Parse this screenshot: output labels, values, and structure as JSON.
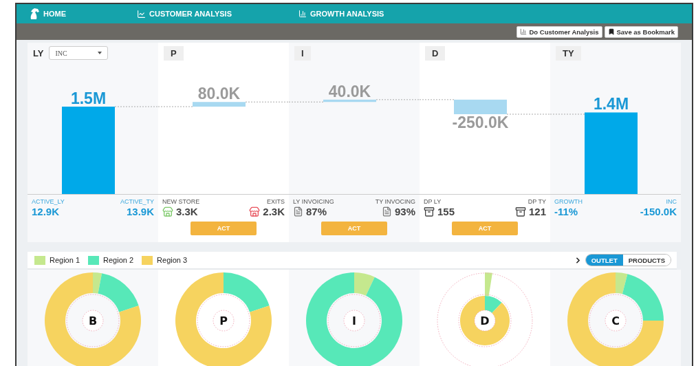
{
  "nav": {
    "items": [
      {
        "label": "HOME",
        "kind": "home"
      },
      {
        "label": "CUSTOMER ANALYSIS",
        "kind": "line"
      },
      {
        "label": "GROWTH ANALYSIS",
        "kind": "bars"
      }
    ]
  },
  "toolbar": {
    "buttons": [
      {
        "label": "Do Customer Analysis",
        "kind": "chart"
      },
      {
        "label": "Save as Bookmark",
        "kind": "bookmark"
      }
    ]
  },
  "waterfall": {
    "measure": {
      "value": "INC"
    },
    "columns": [
      {
        "category": "LY",
        "value": "1.5M"
      },
      {
        "category": "P",
        "value": "80.0K"
      },
      {
        "category": "I",
        "value": "40.0K"
      },
      {
        "category": "D",
        "value": "-250.0K"
      },
      {
        "category": "TY",
        "value": "1.4M"
      }
    ]
  },
  "metrics": [
    {
      "left": {
        "label": "ACTIVE_LY",
        "value": "12.9K",
        "kind": "accent"
      },
      "right": {
        "label": "ACTIVE_TY",
        "value": "13.9K",
        "kind": "accent"
      }
    },
    {
      "left": {
        "label": "NEW STORE",
        "value": "3.3K",
        "kind": "store",
        "color": "#7dc96a"
      },
      "right": {
        "label": "EXITS",
        "value": "2.3K",
        "kind": "store",
        "color": "#e8505b"
      },
      "action": "ACT"
    },
    {
      "left": {
        "label": "LY INVOICING",
        "value": "87%",
        "kind": "invoice"
      },
      "right": {
        "label": "TY INVOCING",
        "value": "93%",
        "kind": "invoice"
      },
      "action": "ACT"
    },
    {
      "left": {
        "label": "DP LY",
        "value": "155",
        "kind": "package"
      },
      "right": {
        "label": "DP TY",
        "value": "121",
        "kind": "package"
      },
      "action": "ACT"
    },
    {
      "left": {
        "label": "GROWTH",
        "value": "-11%",
        "kind": "accent"
      },
      "right": {
        "label": "INC",
        "value": "-150.0K",
        "kind": "accent"
      }
    }
  ],
  "legend": [
    {
      "label": "Region 1",
      "color": "#c5e88e"
    },
    {
      "label": "Region 2",
      "color": "#57e8b8"
    },
    {
      "label": "Region 3",
      "color": "#f6d35f"
    }
  ],
  "view_toggle": {
    "items": [
      {
        "label": "OUTLET",
        "selected": true
      },
      {
        "label": "PRODUCTS",
        "selected": false
      }
    ]
  },
  "donuts": [
    {
      "label": "B"
    },
    {
      "label": "P"
    },
    {
      "label": "I"
    },
    {
      "label": "D"
    },
    {
      "label": "C"
    }
  ]
}
